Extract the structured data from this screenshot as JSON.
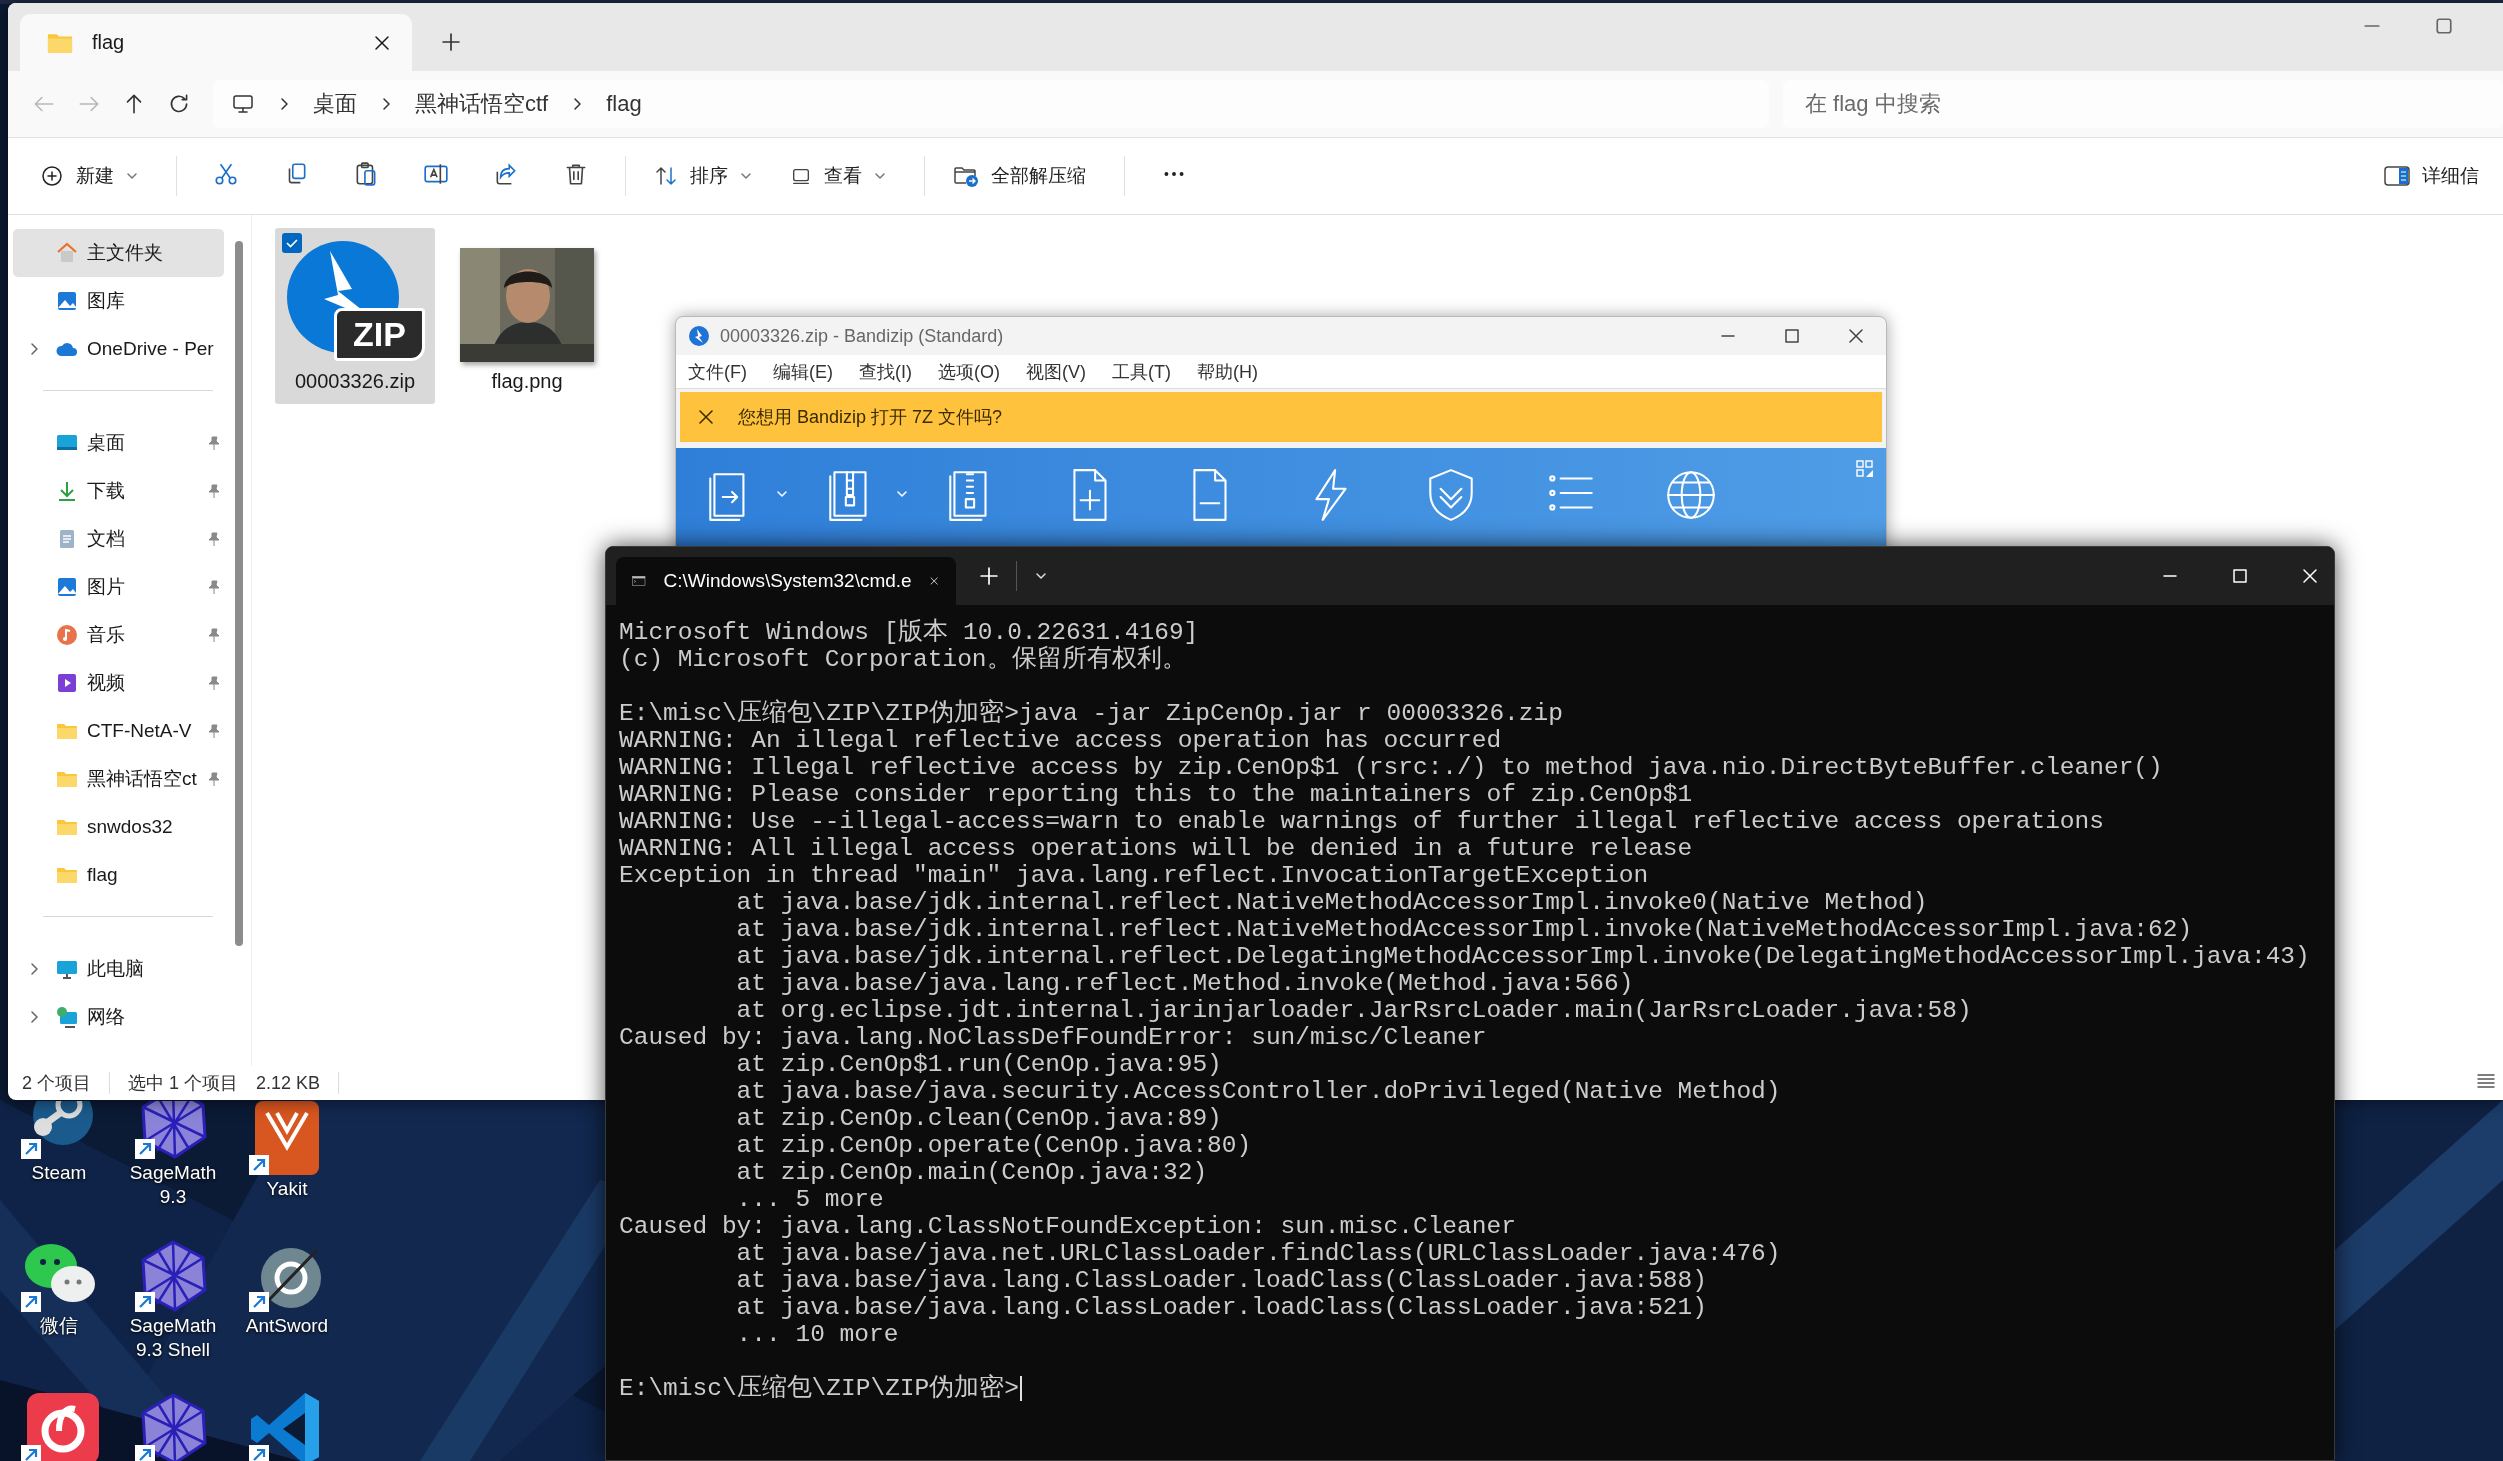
{
  "explorer": {
    "tab_title": "flag",
    "navigation": [
      {
        "kind": "back",
        "disabled": true
      },
      {
        "kind": "forward",
        "disabled": true
      },
      {
        "kind": "up",
        "disabled": false
      },
      {
        "kind": "refresh",
        "disabled": false
      }
    ],
    "breadcrumb": [
      "桌面",
      "黑神话悟空ctf",
      "flag"
    ],
    "search": {
      "placeholder": "在 flag 中搜索"
    },
    "toolbar": {
      "new": "新建",
      "sort": "排序",
      "view": "查看",
      "extract_all": "全部解压缩",
      "details": "详细信"
    },
    "sidebar": [
      [
        {
          "label": "主文件夹",
          "kind": "home",
          "selected": true,
          "pinned": false,
          "expandable": false
        },
        {
          "label": "图库",
          "kind": "gallery",
          "selected": false,
          "pinned": false,
          "expandable": false
        },
        {
          "label": "OneDrive - Per",
          "kind": "cloud",
          "selected": false,
          "pinned": false,
          "expandable": true
        }
      ],
      [
        {
          "label": "桌面",
          "kind": "desktop",
          "selected": false,
          "pinned": true,
          "expandable": false
        },
        {
          "label": "下载",
          "kind": "download",
          "selected": false,
          "pinned": true,
          "expandable": false
        },
        {
          "label": "文档",
          "kind": "document",
          "selected": false,
          "pinned": true,
          "expandable": false
        },
        {
          "label": "图片",
          "kind": "pictures",
          "selected": false,
          "pinned": true,
          "expandable": false
        },
        {
          "label": "音乐",
          "kind": "music",
          "selected": false,
          "pinned": true,
          "expandable": false
        },
        {
          "label": "视频",
          "kind": "video",
          "selected": false,
          "pinned": true,
          "expandable": false
        },
        {
          "label": "CTF-NetA-V",
          "kind": "folder",
          "selected": false,
          "pinned": true,
          "expandable": false
        },
        {
          "label": "黑神话悟空ct",
          "kind": "folder",
          "selected": false,
          "pinned": true,
          "expandable": false
        },
        {
          "label": "snwdos32",
          "kind": "folder",
          "selected": false,
          "pinned": false,
          "expandable": false
        },
        {
          "label": "flag",
          "kind": "folder",
          "selected": false,
          "pinned": false,
          "expandable": false
        }
      ],
      [
        {
          "label": "此电脑",
          "kind": "pc",
          "selected": false,
          "pinned": false,
          "expandable": true
        },
        {
          "label": "网络",
          "kind": "network",
          "selected": false,
          "pinned": false,
          "expandable": true
        }
      ]
    ],
    "files": [
      {
        "name": "00003326.zip",
        "kind": "zip",
        "icon_text": "ZIP",
        "selected": true
      },
      {
        "name": "flag.png",
        "kind": "picture",
        "selected": false
      }
    ],
    "status": {
      "count": "2 个项目",
      "selection": "选中 1 个项目",
      "size": "2.12 KB"
    }
  },
  "bandizip": {
    "title": "00003326.zip - Bandizip (Standard)",
    "menu": [
      "文件(F)",
      "编辑(E)",
      "查找(I)",
      "选项(O)",
      "视图(V)",
      "工具(T)",
      "帮助(H)"
    ],
    "notice": "您想用 Bandizip 打开 7Z 文件吗?"
  },
  "terminal": {
    "tab_title": "C:\\Windows\\System32\\cmd.e",
    "blocks": [
      [
        "Microsoft Windows [版本 10.0.22631.4169]",
        "(c) Microsoft Corporation。保留所有权利。"
      ],
      [
        "E:\\misc\\压缩包\\ZIP\\ZIP伪加密>java -jar ZipCenOp.jar r 00003326.zip",
        "WARNING: An illegal reflective access operation has occurred",
        "WARNING: Illegal reflective access by zip.CenOp$1 (rsrc:./) to method java.nio.DirectByteBuffer.cleaner()",
        "WARNING: Please consider reporting this to the maintainers of zip.CenOp$1",
        "WARNING: Use --illegal-access=warn to enable warnings of further illegal reflective access operations",
        "WARNING: All illegal access operations will be denied in a future release",
        "Exception in thread \"main\" java.lang.reflect.InvocationTargetException",
        "        at java.base/jdk.internal.reflect.NativeMethodAccessorImpl.invoke0(Native Method)",
        "        at java.base/jdk.internal.reflect.NativeMethodAccessorImpl.invoke(NativeMethodAccessorImpl.java:62)",
        "        at java.base/jdk.internal.reflect.DelegatingMethodAccessorImpl.invoke(DelegatingMethodAccessorImpl.java:43)",
        "        at java.base/java.lang.reflect.Method.invoke(Method.java:566)",
        "        at org.eclipse.jdt.internal.jarinjarloader.JarRsrcLoader.main(JarRsrcLoader.java:58)",
        "Caused by: java.lang.NoClassDefFoundError: sun/misc/Cleaner",
        "        at zip.CenOp$1.run(CenOp.java:95)",
        "        at java.base/java.security.AccessController.doPrivileged(Native Method)",
        "        at zip.CenOp.clean(CenOp.java:89)",
        "        at zip.CenOp.operate(CenOp.java:80)",
        "        at zip.CenOp.main(CenOp.java:32)",
        "        ... 5 more",
        "Caused by: java.lang.ClassNotFoundException: sun.misc.Cleaner",
        "        at java.base/java.net.URLClassLoader.findClass(URLClassLoader.java:476)",
        "        at java.base/java.lang.ClassLoader.loadClass(ClassLoader.java:588)",
        "        at java.base/java.lang.ClassLoader.loadClass(ClassLoader.java:521)",
        "        ... 10 more"
      ],
      [
        "E:\\misc\\压缩包\\ZIP\\ZIP伪加密>"
      ]
    ]
  },
  "desktop_icons": [
    {
      "label": "Steam",
      "kind": "steam"
    },
    {
      "label": "SageMath 9.3",
      "kind": "sage"
    },
    {
      "label": "Yakit",
      "kind": "yakit"
    },
    {
      "label": "微信",
      "kind": "wechat"
    },
    {
      "label": "SageMath 9.3 Shell",
      "kind": "sage"
    },
    {
      "label": "AntSword",
      "kind": "antsword"
    },
    {
      "kind": "netease"
    },
    {
      "kind": "sage"
    },
    {
      "kind": "vscode"
    }
  ]
}
